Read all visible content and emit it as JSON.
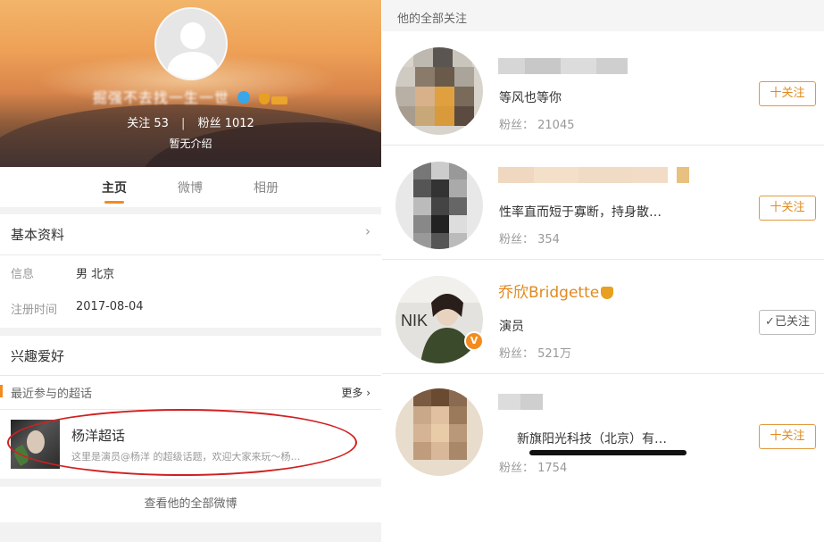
{
  "profile": {
    "nickname": "掘强不去找一生一世",
    "follow_label": "关注",
    "follow_count": "53",
    "fans_label": "粉丝",
    "fans_count": "1012",
    "intro": "暂无介绍"
  },
  "tabs": [
    {
      "label": "主页",
      "active": true
    },
    {
      "label": "微博",
      "active": false
    },
    {
      "label": "相册",
      "active": false
    }
  ],
  "basic_info": {
    "title": "基本资料",
    "rows": [
      {
        "label": "信息",
        "value": "男  北京"
      },
      {
        "label": "注册时间",
        "value": "2017-08-04"
      }
    ]
  },
  "hobbies": {
    "title": "兴趣爱好",
    "section_label": "最近参与的超话",
    "more_label": "更多",
    "super_topic": {
      "title": "杨洋超话",
      "description": "这里是演员@杨洋 的超级话题，欢迎大家来玩～杨…"
    }
  },
  "view_all": "查看他的全部微博",
  "following": {
    "header": "他的全部关注",
    "users": [
      {
        "name": "",
        "desc": "等风也等你",
        "fans": "粉丝： 21045",
        "button": "十关注"
      },
      {
        "name": "",
        "desc": "性率直而短于寡断，持身散…",
        "fans": "粉丝： 354",
        "button": "十关注"
      },
      {
        "name": "乔欣Bridgette",
        "desc": "演员",
        "fans": "粉丝： 521万",
        "button": "✓已关注"
      },
      {
        "name": "",
        "desc": "新旗阳光科技（北京）有…",
        "fans": "粉丝： 1754",
        "button": "十关注"
      }
    ]
  },
  "colors": {
    "accent": "#f28b20",
    "follow_border": "#e09a3e",
    "annotation_red": "#d02020"
  }
}
